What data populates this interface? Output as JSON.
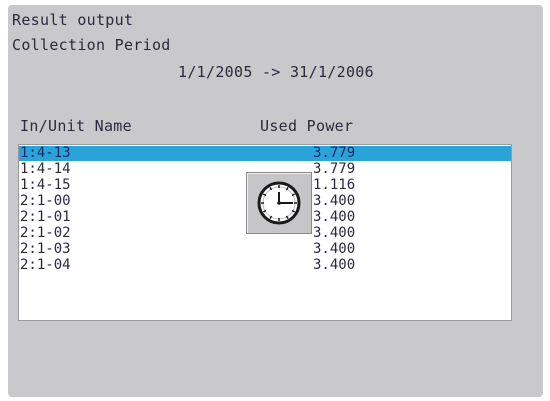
{
  "header": {
    "title": "Result output",
    "period_label": "Collection Period",
    "period_range": "1/1/2005 -> 31/1/2006"
  },
  "columns": {
    "name": "In/Unit Name",
    "power": "Used Power"
  },
  "rows": [
    {
      "name": "1:4-13",
      "power": "3.779",
      "selected": true
    },
    {
      "name": "1:4-14",
      "power": "3.779",
      "selected": false
    },
    {
      "name": "1:4-15",
      "power": "1.116",
      "selected": false
    },
    {
      "name": "2:1-00",
      "power": "3.400",
      "selected": false
    },
    {
      "name": "2:1-01",
      "power": "3.400",
      "selected": false
    },
    {
      "name": "2:1-02",
      "power": "3.400",
      "selected": false
    },
    {
      "name": "2:1-03",
      "power": "3.400",
      "selected": false
    },
    {
      "name": "2:1-04",
      "power": "3.400",
      "selected": false
    }
  ],
  "busy_indicator": {
    "icon": "clock-icon"
  },
  "colors": {
    "background": "#c9c9cb",
    "list_background": "#ffffff",
    "selection": "#2aa3d8",
    "text": "#2a2a3e"
  }
}
